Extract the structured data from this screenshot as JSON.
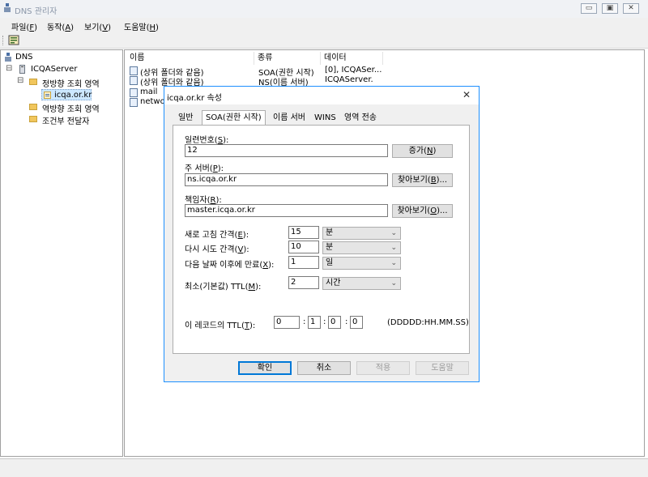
{
  "window": {
    "title": "DNS 관리자",
    "controls": [
      "▭",
      "▣",
      "✕"
    ]
  },
  "menubar": [
    {
      "label": "파일(",
      "key": "F",
      "tail": ")"
    },
    {
      "label": "동작(",
      "key": "A",
      "tail": ")"
    },
    {
      "label": "보기(",
      "key": "V",
      "tail": ")"
    },
    {
      "label": "도움말(",
      "key": "H",
      "tail": ")"
    }
  ],
  "tree": {
    "root": "DNS",
    "server": "ICQAServer",
    "forward_zone": "정방향 조회 영역",
    "zone": "icqa.or.kr",
    "reverse_zone": "역방향 조회 영역",
    "conditional": "조건부 전달자",
    "expand_minus": "⊟"
  },
  "list": {
    "columns": [
      "이름",
      "종류",
      "데이터"
    ],
    "rows": [
      {
        "name": "(상위 폴더와 같음)",
        "type": "SOA(권한 시작)",
        "data": "[0], ICQASer..."
      },
      {
        "name": "(상위 폴더와 같음)",
        "type": "NS(이름 서버)",
        "data": "ICQAServer."
      },
      {
        "name": "mail",
        "type": "",
        "data": ""
      },
      {
        "name": "networ",
        "type": "",
        "data": ""
      }
    ]
  },
  "dialog": {
    "title": "icqa.or.kr 속성",
    "close": "✕",
    "tabs": [
      "일반",
      "SOA(권한 시작)",
      "이름 서버",
      "WINS",
      "영역 전송"
    ],
    "serial": {
      "label": "일련번호(",
      "key": "S",
      "tail": "):",
      "value": "12",
      "button": "증가(",
      "button_key": "N",
      "button_tail": ")"
    },
    "primary": {
      "label": "주 서버(",
      "key": "P",
      "tail": "):",
      "value": "ns.icqa.or.kr",
      "button": "찾아보기(",
      "button_key": "B",
      "button_tail": ")..."
    },
    "responsible": {
      "label": "책임자(",
      "key": "R",
      "tail": "):",
      "value": "master.icqa.or.kr",
      "button": "찾아보기(",
      "button_key": "O",
      "button_tail": ")..."
    },
    "refresh": {
      "label": "새로 고침 간격(",
      "key": "E",
      "tail": "):",
      "value": "15",
      "unit": "분"
    },
    "retry": {
      "label": "다시 시도 간격(",
      "key": "V",
      "tail": "):",
      "value": "10",
      "unit": "분"
    },
    "expire": {
      "label": "다음 날짜 이후에 만료(",
      "key": "X",
      "tail": "):",
      "value": "1",
      "unit": "일"
    },
    "minttl": {
      "label": "최소(기본값) TTL(",
      "key": "M",
      "tail": "):",
      "value": "2",
      "unit": "시간"
    },
    "recttl": {
      "label": "이 레코드의 TTL(",
      "key": "T",
      "tail": "):",
      "d": "0",
      "h": "1",
      "m": "0",
      "s": "0",
      "sep": ":",
      "format": "(DDDDD:HH.MM.SS)"
    },
    "buttons": {
      "ok": "확인",
      "cancel": "취소",
      "apply": "적용",
      "help": "도움말"
    }
  }
}
